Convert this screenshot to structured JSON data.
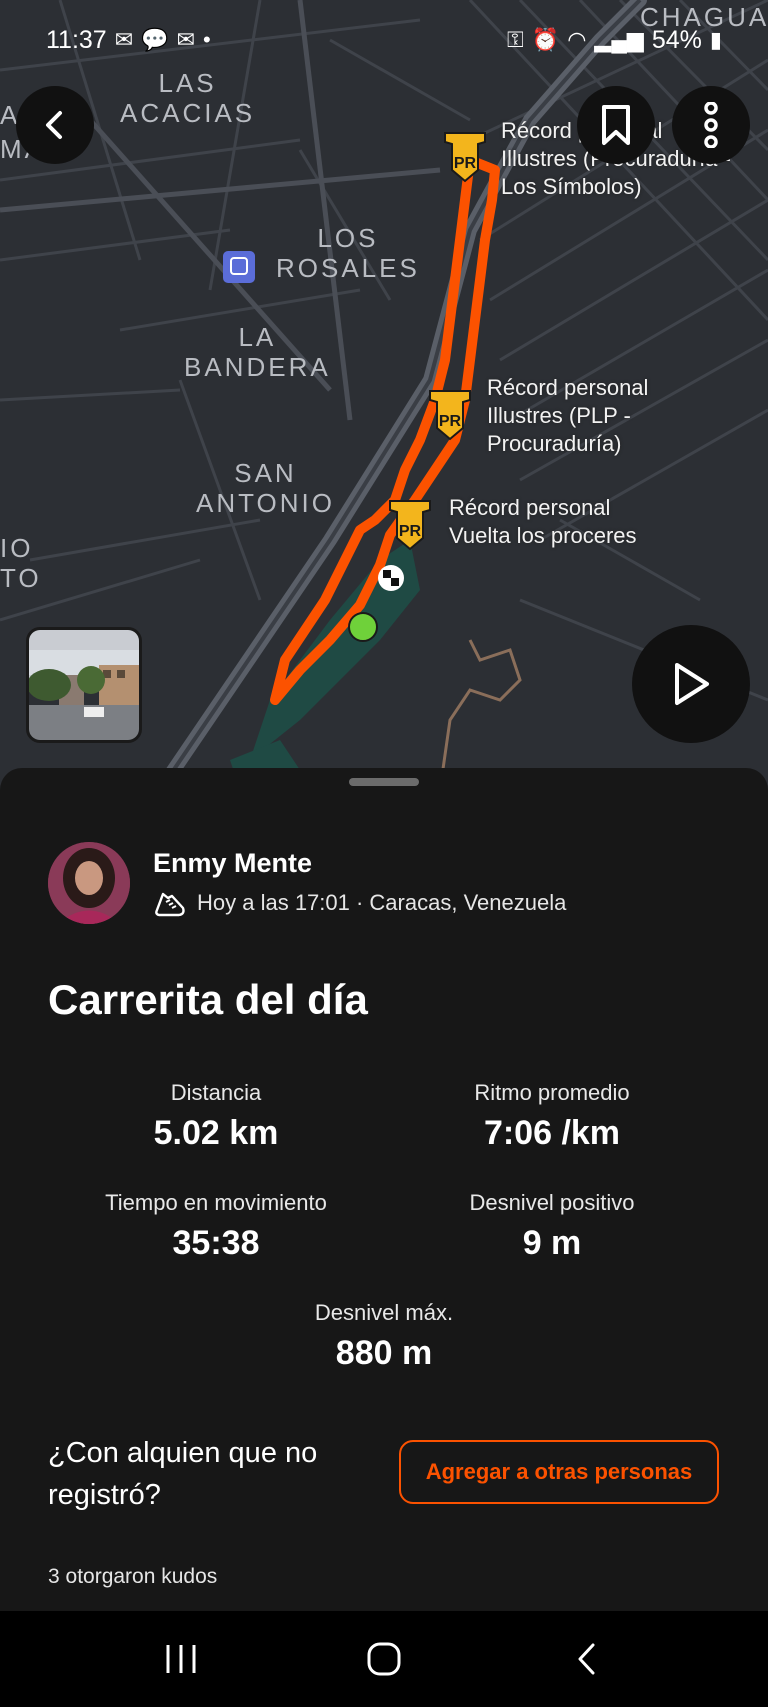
{
  "status_bar": {
    "time": "11:37",
    "battery": "54%",
    "left_icons": [
      "gmail-icon",
      "chat-icon",
      "gmail-icon",
      "dot-icon"
    ],
    "right_icons": [
      "vpn-key-icon",
      "alarm-icon",
      "wifi-icon",
      "signal-icon",
      "signal-icon",
      "battery-icon"
    ]
  },
  "map": {
    "places": [
      {
        "id": "las-acacias",
        "text": "LAS\nACACIAS"
      },
      {
        "id": "chagua",
        "text": "CHAGUA"
      },
      {
        "id": "los-rosales",
        "text": "LOS\nROSALES"
      },
      {
        "id": "la-bandera",
        "text": "LA\nBANDERA"
      },
      {
        "id": "san-antonio",
        "text": "SAN\nANTONIO"
      },
      {
        "id": "left-edge-1",
        "text": "A   E"
      },
      {
        "id": "left-edge-2",
        "text": "MA"
      },
      {
        "id": "left-edge-3",
        "text": "IO\nTO"
      }
    ],
    "pr_labels": [
      {
        "text": "Récord personal\nIllustres (Procuraduría -\nLos Símbolos)"
      },
      {
        "text": "Récord personal\nIllustres (PLP -\nProcuraduría)"
      },
      {
        "text": "Récord personal\nVuelta los proceres"
      }
    ],
    "pr_badge": "PR",
    "accent_color": "#fc5200",
    "start_color": "#6fd13a"
  },
  "map_buttons": {
    "back": "chevron-left-icon",
    "bookmark": "bookmark-icon",
    "more": "more-vertical-icon",
    "play": "play-icon"
  },
  "activity": {
    "athlete_name": "Enmy Mente",
    "meta": "Hoy a las 17:01 · Caracas, Venezuela",
    "title": "Carrerita del día",
    "stats": [
      {
        "label": "Distancia",
        "value": "5.02 km"
      },
      {
        "label": "Ritmo promedio",
        "value": "7:06 /km"
      },
      {
        "label": "Tiempo en movimiento",
        "value": "35:38"
      },
      {
        "label": "Desnivel positivo",
        "value": "9 m"
      },
      {
        "label": "Desnivel máx.",
        "value": "880 m"
      }
    ],
    "ask_text": "¿Con alquien que no registró?",
    "add_button": "Agregar a otras personas",
    "kudos": "3 otorgaron kudos"
  },
  "navbar": {
    "recents": "recents-icon",
    "home": "home-icon",
    "back": "back-icon"
  }
}
